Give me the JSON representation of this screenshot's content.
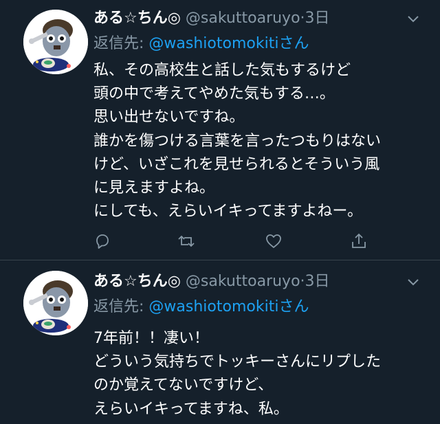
{
  "tweets": [
    {
      "author": {
        "name": "ある☆ちん◎",
        "handle": "@sakuttoaruyo"
      },
      "dot": "·",
      "time": "3日",
      "reply_label": "返信先:",
      "reply_user": "@washiotomokiti",
      "reply_suffix": "さん",
      "lines": [
        "私、その高校生と話した気もするけど",
        "頭の中で考えてやめた気もする…。",
        "思い出せないですね。",
        "誰かを傷つける言葉を言ったつもりはない",
        "けど、いざこれを見せられるとそういう風",
        "に見えますよね。",
        "にしても、えらいイキってますよねー。"
      ],
      "actions": [
        {
          "icon": "reply-icon"
        },
        {
          "icon": "retweet-icon"
        },
        {
          "icon": "like-icon"
        },
        {
          "icon": "share-icon"
        }
      ]
    },
    {
      "author": {
        "name": "ある☆ちん◎",
        "handle": "@sakuttoaruyo"
      },
      "dot": "·",
      "time": "3日",
      "reply_label": "返信先:",
      "reply_user": "@washiotomokiti",
      "reply_suffix": "さん",
      "lines": [
        "7年前！！凄い！",
        "どういう気持ちでトッキーさんにリプした",
        "のか覚えてないですけど、",
        "えらいイキってますね、私。"
      ]
    }
  ],
  "colors": {
    "background": "#15202b",
    "secondary_text": "#8899a6",
    "link": "#1da1f2",
    "divider": "#38444d"
  }
}
